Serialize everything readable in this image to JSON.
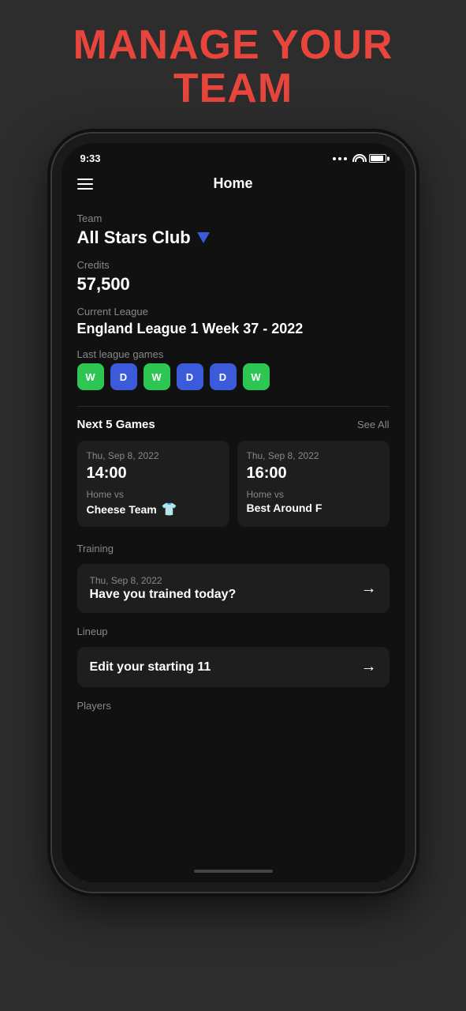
{
  "page": {
    "title_line1": "MANAGE YOUR",
    "title_line2": "TEAM"
  },
  "status_bar": {
    "time": "9:33",
    "wifi": true,
    "battery": true
  },
  "nav": {
    "title": "Home",
    "menu_label": "Menu"
  },
  "team": {
    "label": "Team",
    "name": "All Stars Club"
  },
  "credits": {
    "label": "Credits",
    "value": "57,500"
  },
  "league": {
    "label": "Current League",
    "name": "England League 1 Week 37 - 2022"
  },
  "last_games": {
    "label": "Last league games",
    "results": [
      {
        "result": "W",
        "type": "win"
      },
      {
        "result": "D",
        "type": "draw"
      },
      {
        "result": "W",
        "type": "win"
      },
      {
        "result": "D",
        "type": "draw"
      },
      {
        "result": "D",
        "type": "draw"
      },
      {
        "result": "W",
        "type": "win"
      }
    ]
  },
  "next_games": {
    "label": "Next 5 Games",
    "see_all": "See All",
    "games": [
      {
        "date": "Thu, Sep 8, 2022",
        "time": "14:00",
        "venue": "Home vs",
        "team": "Cheese Team",
        "has_jersey": true
      },
      {
        "date": "Thu, Sep 8, 2022",
        "time": "16:00",
        "venue": "Home vs",
        "team": "Best Around F",
        "has_jersey": false
      }
    ]
  },
  "training": {
    "label": "Training",
    "date": "Thu, Sep 8, 2022",
    "prompt": "Have you trained today?"
  },
  "lineup": {
    "label": "Lineup",
    "cta": "Edit your starting 11"
  },
  "players": {
    "label": "Players"
  }
}
